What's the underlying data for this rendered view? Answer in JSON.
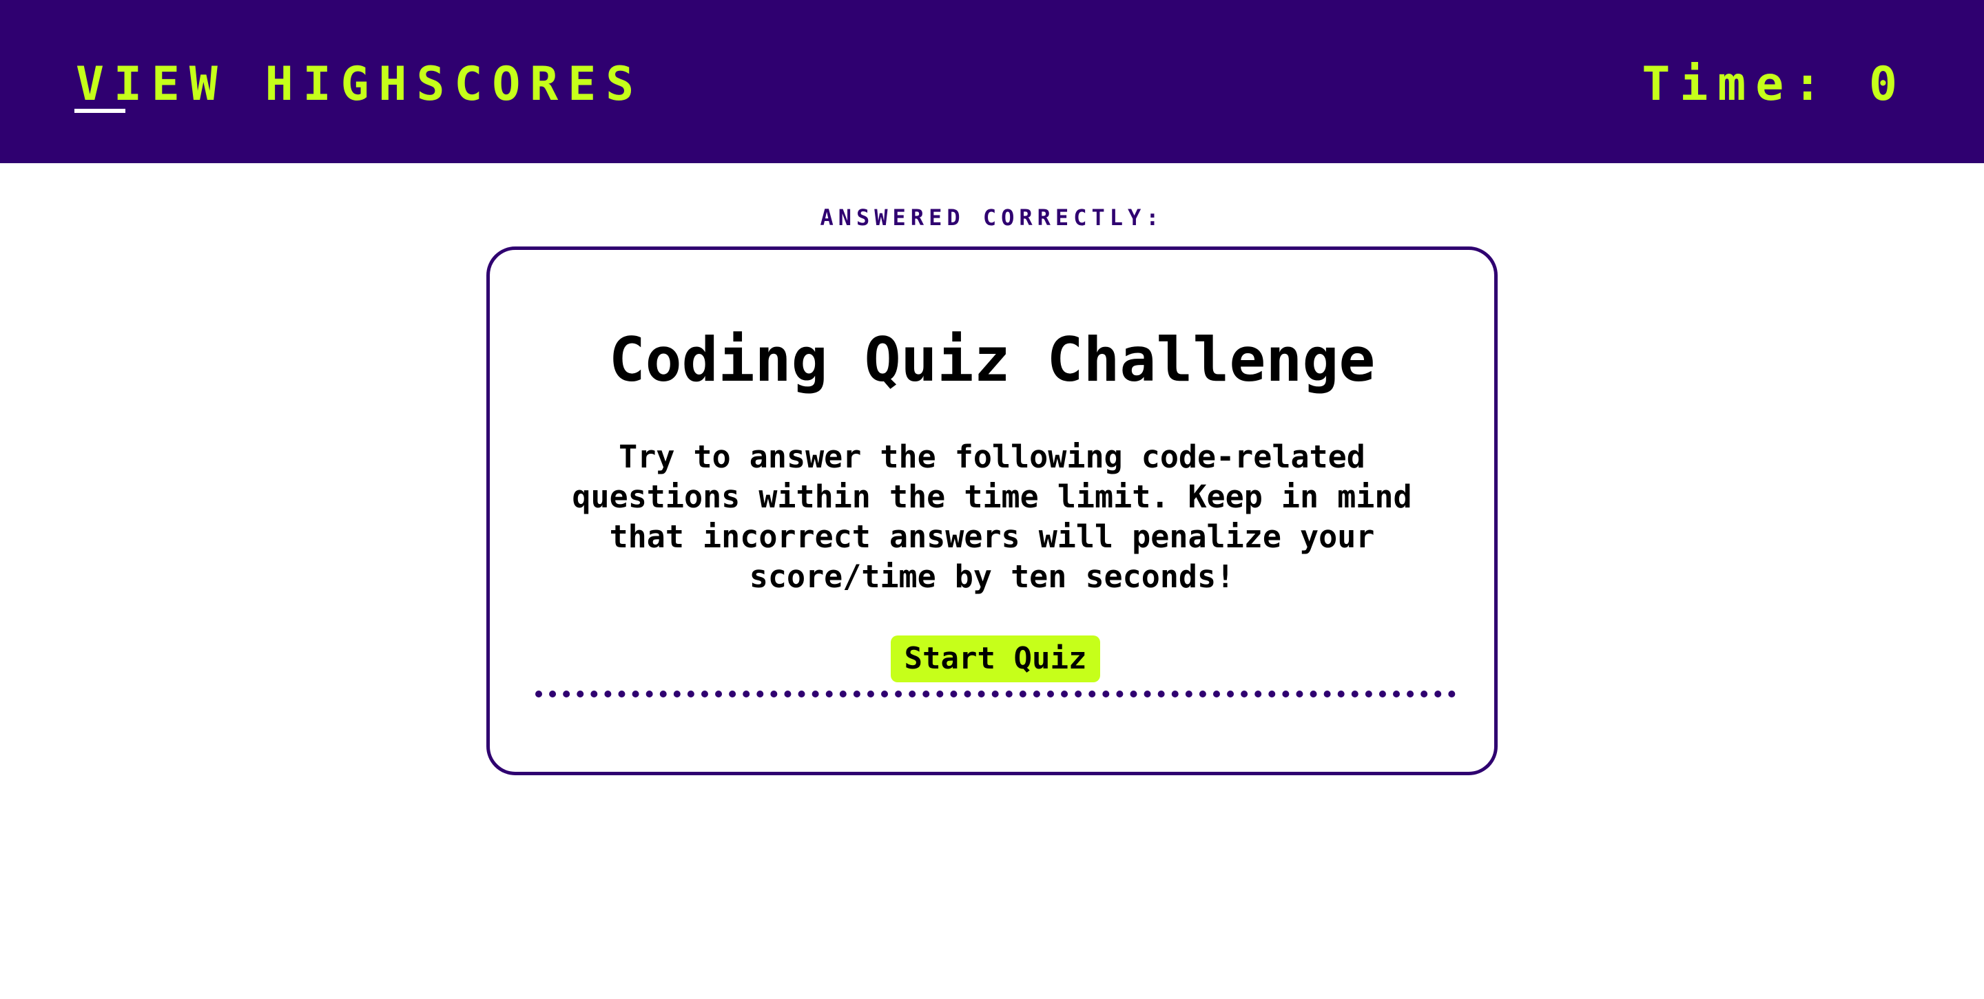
{
  "header": {
    "highscores_link": "View Highscores",
    "timer_label": "Time:",
    "timer_value": "0"
  },
  "status": {
    "answered_correctly": "ANSWERED CORRECTLY:"
  },
  "quiz": {
    "title": "Coding Quiz Challenge",
    "description": "Try to answer the following code-related questions within the time limit. Keep in mind that incorrect answers will penalize your score/time by ten seconds!",
    "start_button": "Start Quiz"
  },
  "colors": {
    "header_bg": "#2f0070",
    "accent": "#c6ff1a",
    "border": "#2f0070"
  }
}
